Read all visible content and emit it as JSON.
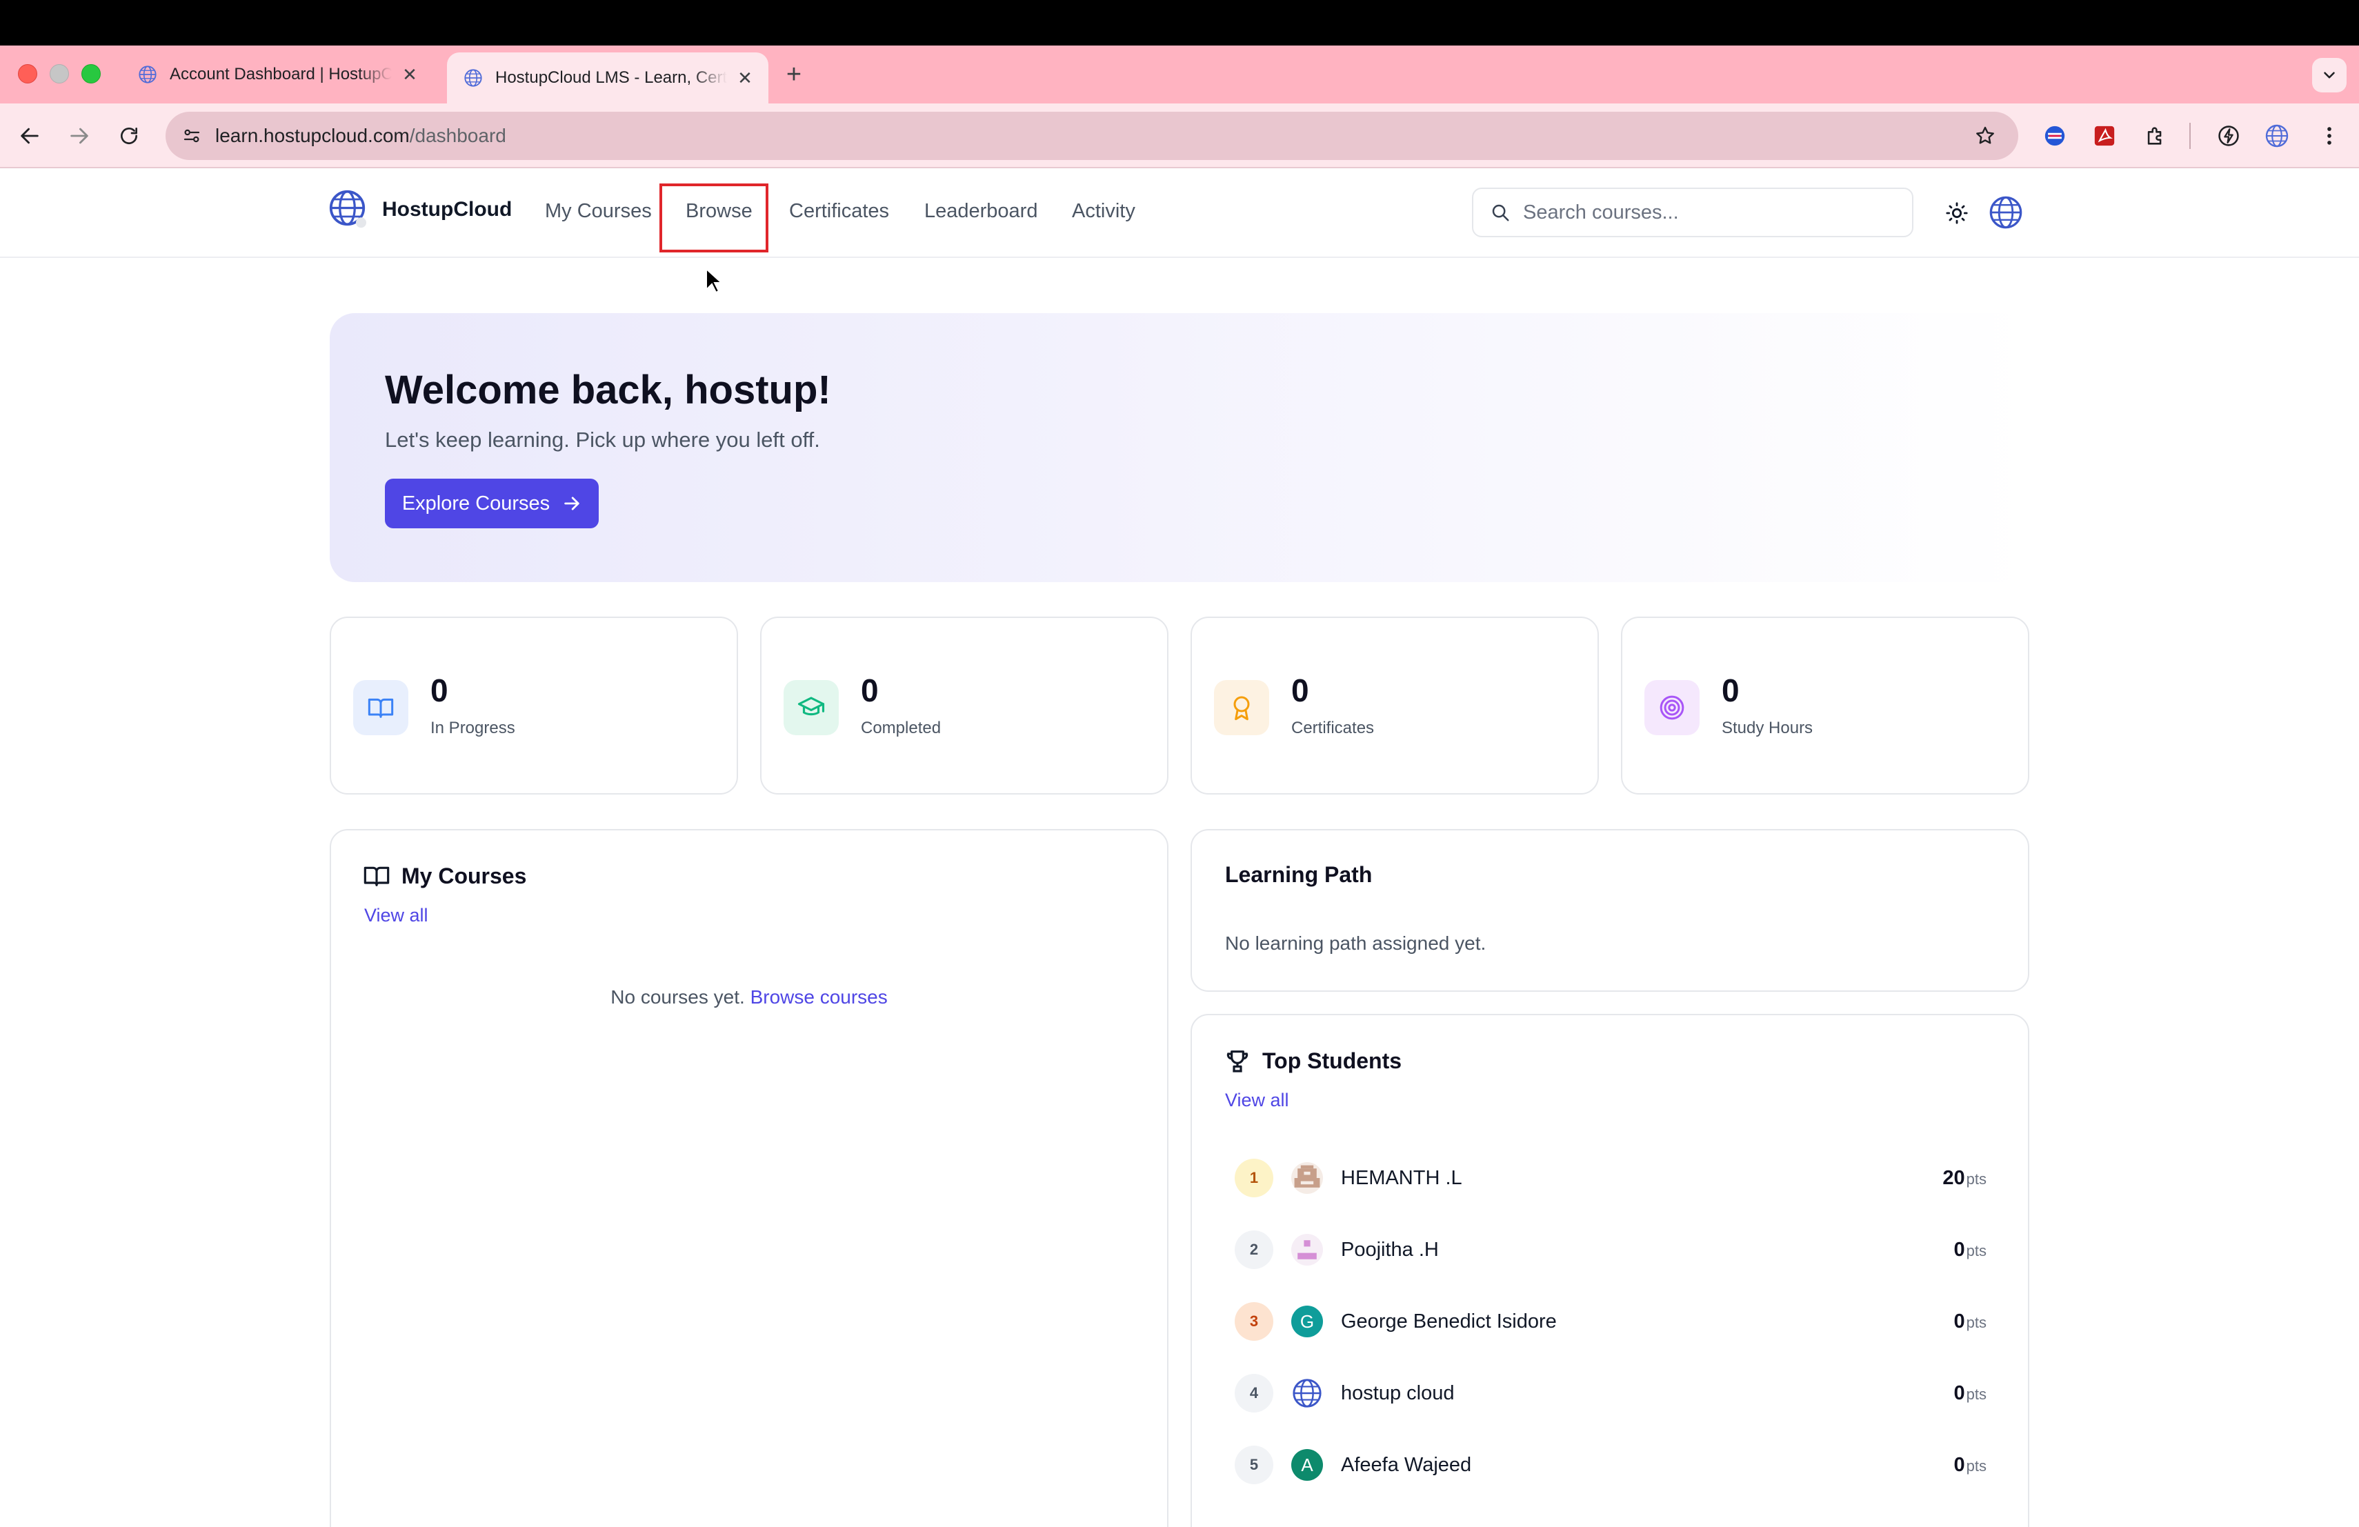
{
  "browser": {
    "tabs": [
      {
        "title": "Account Dashboard | HostupCloud",
        "active": false
      },
      {
        "title": "HostupCloud LMS - Learn, Certify",
        "active": true
      }
    ],
    "new_tab": "+",
    "url_domain": "learn.hostupcloud.com",
    "url_path": "/dashboard"
  },
  "header": {
    "brand": "HostupCloud",
    "nav": [
      "My Courses",
      "Browse",
      "Certificates",
      "Leaderboard",
      "Activity"
    ],
    "search_placeholder": "Search courses..."
  },
  "hero": {
    "title": "Welcome back, hostup!",
    "subtitle": "Let's keep learning. Pick up where you left off.",
    "cta": "Explore Courses"
  },
  "stats": [
    {
      "value": "0",
      "label": "In Progress",
      "icon": "book-open-icon",
      "color": "#3b82f6"
    },
    {
      "value": "0",
      "label": "Completed",
      "icon": "graduation-cap-icon",
      "color": "#10b981"
    },
    {
      "value": "0",
      "label": "Certificates",
      "icon": "award-icon",
      "color": "#f59e0b"
    },
    {
      "value": "0",
      "label": "Study Hours",
      "icon": "target-icon",
      "color": "#a855f7"
    }
  ],
  "my_courses": {
    "title": "My Courses",
    "view_all": "View all",
    "empty_text": "No courses yet.",
    "empty_link": "Browse courses"
  },
  "learning_path": {
    "title": "Learning Path",
    "empty_text": "No learning path assigned yet."
  },
  "top_students": {
    "title": "Top Students",
    "view_all": "View all",
    "unit": "pts",
    "list": [
      {
        "rank": "1",
        "name": "HEMANTH .L",
        "points": "20",
        "avatar": "pixel"
      },
      {
        "rank": "2",
        "name": "Poojitha .H",
        "points": "0",
        "avatar": "pixel-pink"
      },
      {
        "rank": "3",
        "name": "George Benedict Isidore",
        "points": "0",
        "avatar": "G"
      },
      {
        "rank": "4",
        "name": "hostup cloud",
        "points": "0",
        "avatar": "globe"
      },
      {
        "rank": "5",
        "name": "Afeefa Wajeed",
        "points": "0",
        "avatar": "A"
      }
    ]
  },
  "colors": {
    "accent": "#4f46e5",
    "highlight_box": "#e0262b",
    "tabstrip": "#ffb3c1"
  }
}
